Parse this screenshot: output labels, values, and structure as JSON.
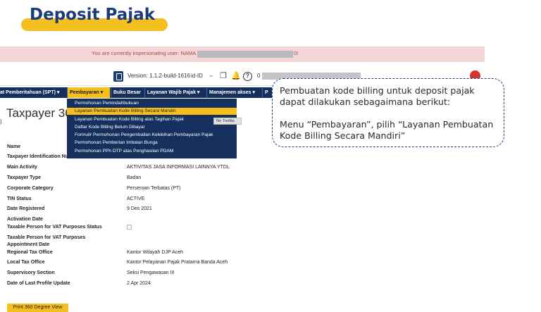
{
  "slide": {
    "title": "Deposit Pajak"
  },
  "banner": {
    "text": "You are currently impersonating user: NAMA",
    "tail": "0!"
  },
  "topbar": {
    "version": "Version: 1.1.2-build-1616",
    "lang": "id-ID",
    "lang_chevron": "⌄",
    "doc_icon_glyph": "❖",
    "bell_glyph": "🔔",
    "help_glyph": "?",
    "prefix": "0"
  },
  "nav": {
    "items": [
      {
        "label": "at Pemberitahuan (SPT) ▾"
      },
      {
        "label": "Pembayaran ▾",
        "active": true
      },
      {
        "label": "Buku Besar"
      },
      {
        "label": "Layanan Wajib Pajak ▾"
      },
      {
        "label": "Manajemen akses ▾"
      },
      {
        "label": "P"
      }
    ]
  },
  "dropdown": {
    "items": [
      {
        "label": "Permohonan Pemindahbukuan"
      },
      {
        "label": "Layanan Pembuatan Kode Billing Secara Mandiri",
        "active": true
      },
      {
        "label": "Layanan Pembuatan Kode Billing atas Tagihan Pajak"
      },
      {
        "label": "Daftar Kode Billing Belum Dibayar"
      },
      {
        "label": "Formulir Permohonan Pengembalian Kelebihan Pembayaran Pajak"
      },
      {
        "label": "Permohonan Pemberian Imbalan Bunga"
      },
      {
        "label": "Permohonan PPh DTP atas Penghasilan PDAM"
      }
    ],
    "tooltip": "No Tooltip"
  },
  "page": {
    "title": "Taxpayer 360",
    "frag": ")"
  },
  "profile": {
    "rows": [
      {
        "label": "Name",
        "value": ""
      },
      {
        "label": "Taxpayer Identification Number",
        "value": ""
      },
      {
        "label": "Main Activity",
        "value": "AKTIVITAS JASA INFORMASI LAINNYA YTDL"
      },
      {
        "label": "Taxpayer Type",
        "value": "Badan"
      },
      {
        "label": "Corporate Category",
        "value": "Perseroan Terbatas (PT)"
      },
      {
        "label": "TIN Status",
        "value": "ACTIVE"
      },
      {
        "label": "Date Registered",
        "value": "9 Des 2021"
      },
      {
        "label": "Activation Date",
        "value": ""
      },
      {
        "label": "Taxable Person for VAT Purposes Status",
        "value": ""
      },
      {
        "label": "Taxable Person for VAT Purposes",
        "value": ""
      },
      {
        "label": "Appointment Date",
        "value": ""
      },
      {
        "label": "Regional Tax Office",
        "value": "Kantor Wilayah DJP Aceh"
      },
      {
        "label": "Local Tax Office",
        "value": "Kantor Pelayanan Pajak Pratama Banda Aceh"
      },
      {
        "label": "Supervisory Section",
        "value": "Seksi Pengawasan III"
      },
      {
        "label": "Date of Last Profile Update",
        "value": "2 Apr 2024"
      }
    ]
  },
  "print_button": "Print 360 Degree View",
  "callout": {
    "p1": "Pembuatan kode billing untuk deposit pajak dapat dilakukan sebagaimana berikut:",
    "p2": "Menu “Pembayaran”, pilih “Layanan Pembuatan Kode Billing Secara Mandiri”"
  },
  "colors": {
    "navy": "#16305d",
    "accent": "#f5bf1f",
    "banner": "#f4d6d8",
    "banner_text": "#a3484f"
  }
}
